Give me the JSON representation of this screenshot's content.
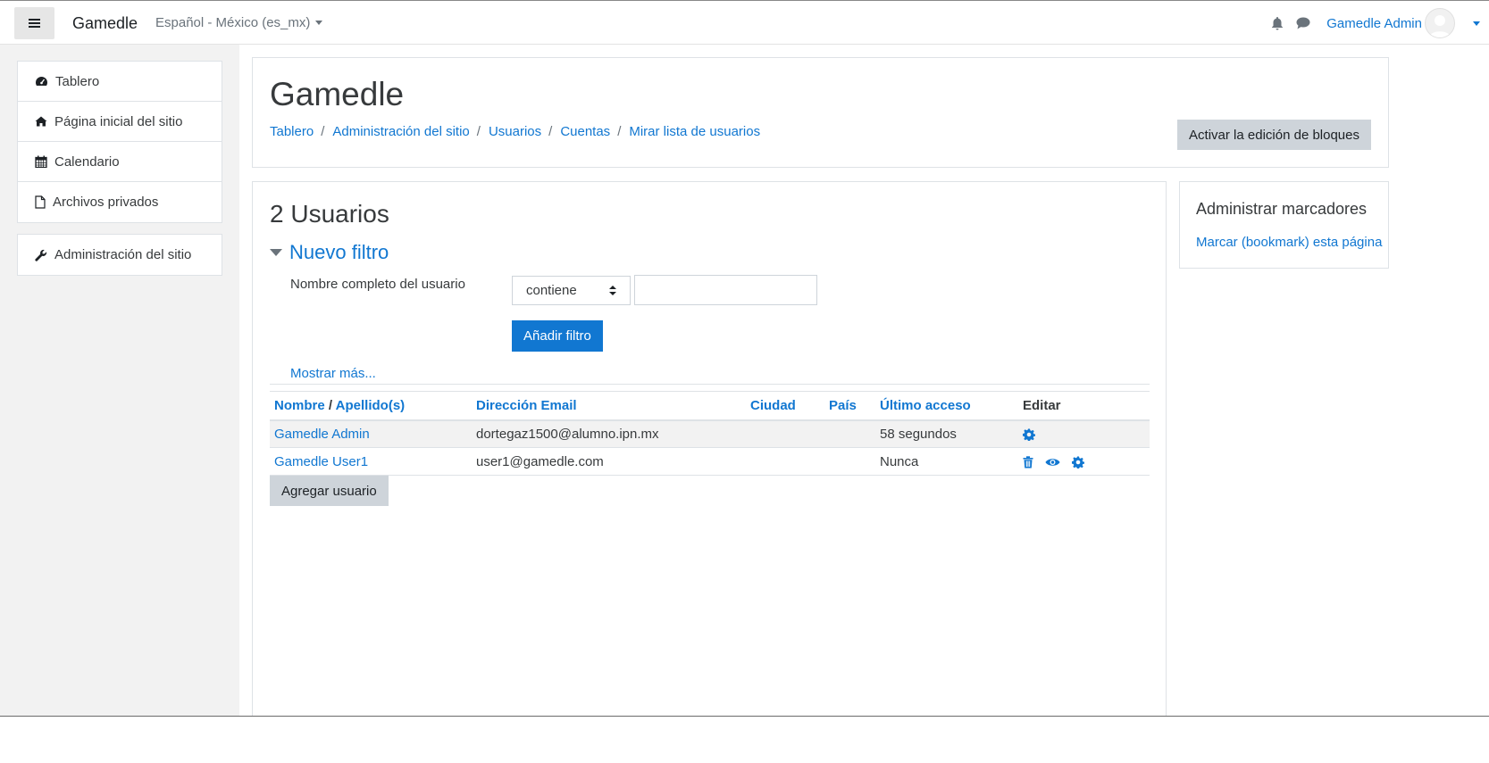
{
  "navbar": {
    "brand": "Gamedle",
    "language": "Español - México (es_mx)",
    "user_name": "Gamedle Admin",
    "icons": [
      "menu-icon",
      "bell-icon",
      "chat-icon",
      "avatar-icon"
    ]
  },
  "drawer": {
    "items": [
      {
        "label": "Tablero",
        "icon": "dashboard-icon"
      },
      {
        "label": "Página inicial del sitio",
        "icon": "home-icon"
      },
      {
        "label": "Calendario",
        "icon": "calendar-icon"
      },
      {
        "label": "Archivos privados",
        "icon": "file-icon"
      }
    ],
    "admin": {
      "label": "Administración del sitio",
      "icon": "wrench-icon"
    }
  },
  "header": {
    "title": "Gamedle",
    "breadcrumb": [
      "Tablero",
      "Administración del sitio",
      "Usuarios",
      "Cuentas",
      "Mirar lista de usuarios"
    ],
    "edit_button": "Activar la edición de bloques"
  },
  "main": {
    "users_count": "2 Usuarios",
    "filter": {
      "legend": "Nuevo filtro",
      "field_label": "Nombre completo del usuario",
      "operator": "contiene",
      "value": "",
      "add_button": "Añadir filtro",
      "show_more": "Mostrar más..."
    },
    "table": {
      "headers": {
        "name": "Nombre",
        "slash": "/",
        "surname": "Apellido(s)",
        "email": "Dirección Email",
        "city": "Ciudad",
        "country": "País",
        "last_access": "Último acceso",
        "edit": "Editar"
      },
      "rows": [
        {
          "name": "Gamedle Admin",
          "email": "dortegaz1500@alumno.ipn.mx",
          "city": "",
          "country": "",
          "last_access": "58 segundos",
          "actions": [
            "settings-icon"
          ]
        },
        {
          "name": "Gamedle User1",
          "email": "user1@gamedle.com",
          "city": "",
          "country": "",
          "last_access": "Nunca",
          "actions": [
            "trash-icon",
            "eye-icon",
            "settings-icon"
          ]
        }
      ]
    },
    "add_user_button": "Agregar usuario"
  },
  "bookmarks": {
    "title": "Administrar marcadores",
    "link": "Marcar (bookmark) esta página"
  },
  "colors": {
    "link": "#1177d1",
    "primary": "#1177d1",
    "secondary_button": "#ced4da",
    "drawer_bg": "#f2f2f2"
  }
}
